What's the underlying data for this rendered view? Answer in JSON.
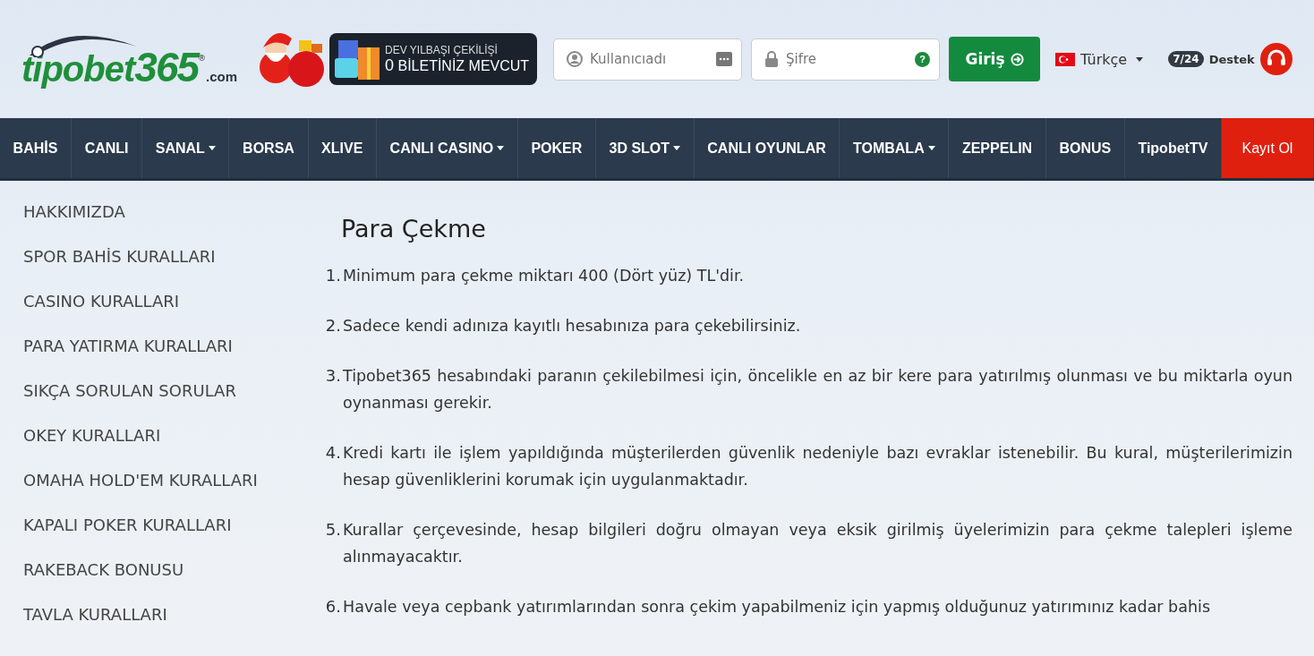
{
  "header": {
    "logo": {
      "name": "tipobet",
      "number": "365",
      "reg": "®",
      "domain": ".com"
    },
    "promo": {
      "title": "DEV YILBAŞI ÇEKİLİŞİ",
      "count": "0",
      "text": "BİLETİNİZ MEVCUT"
    },
    "username": {
      "placeholder": "Kullanıcıadı"
    },
    "password": {
      "placeholder": "Şifre",
      "help": "?"
    },
    "login": "Giriş",
    "language": "Türkçe",
    "support": {
      "badge": "7/24",
      "label": "Destek"
    }
  },
  "nav": [
    {
      "label": "BAHİS",
      "dropdown": false,
      "kind": "link"
    },
    {
      "label": "CANLI",
      "dropdown": false,
      "kind": "link"
    },
    {
      "label": "SANAL",
      "dropdown": true,
      "kind": "link"
    },
    {
      "label": "BORSA",
      "dropdown": false,
      "kind": "link"
    },
    {
      "label": "XLIVE",
      "dropdown": false,
      "kind": "link"
    },
    {
      "label": "CANLI CASINO",
      "dropdown": true,
      "kind": "link"
    },
    {
      "label": "POKER",
      "dropdown": false,
      "kind": "link"
    },
    {
      "label": "3D SLOT",
      "dropdown": true,
      "kind": "link"
    },
    {
      "label": "CANLI OYUNLAR",
      "dropdown": false,
      "kind": "link"
    },
    {
      "label": "TOMBALA",
      "dropdown": true,
      "kind": "link"
    },
    {
      "label": "ZEPPELIN",
      "dropdown": false,
      "kind": "link"
    },
    {
      "label": "BONUS",
      "dropdown": false,
      "kind": "link"
    },
    {
      "label": "TipobetTV",
      "dropdown": false,
      "kind": "link"
    },
    {
      "label": "Kayıt Ol",
      "dropdown": false,
      "kind": "register"
    }
  ],
  "sidebar": {
    "items": [
      "HAKKIMIZDA",
      "SPOR BAHİS KURALLARI",
      "CASINO KURALLARI",
      "PARA YATIRMA KURALLARI",
      "SIKÇA SORULAN SORULAR",
      "OKEY KURALLARI",
      "OMAHA HOLD'EM KURALLARI",
      "KAPALI POKER KURALLARI",
      "RAKEBACK BONUSU",
      "TAVLA KURALLARI"
    ]
  },
  "article": {
    "title": "Para Çekme",
    "items": [
      {
        "number": "1.",
        "text": "Minimum para çekme miktarı 400 (Dört yüz) TL'dir."
      },
      {
        "number": "2.",
        "text": "Sadece kendi adınıza kayıtlı hesabınıza para çekebilirsiniz."
      },
      {
        "number": "3.",
        "text": "Tipobet365 hesabındaki paranın çekilebilmesi için, öncelikle en az bir kere para yatırılmış olunması ve bu miktarla oyun oynanması gerekir."
      },
      {
        "number": "4.",
        "text": "Kredi kartı ile işlem yapıldığında müşterilerden güvenlik nedeniyle bazı evraklar istenebilir. Bu kural, müşterilerimizin hesap güvenliklerini korumak için uygulanmaktadır."
      },
      {
        "number": "5.",
        "text": "Kurallar çerçevesinde, hesap bilgileri doğru olmayan veya eksik girilmiş üyelerimizin para çekme talepleri işleme alınmayacaktır."
      },
      {
        "number": "6.",
        "text": "Havale veya cepbank yatırımlarından sonra çekim yapabilmeniz için yapmış olduğunuz yatırımınız kadar bahis"
      }
    ]
  }
}
